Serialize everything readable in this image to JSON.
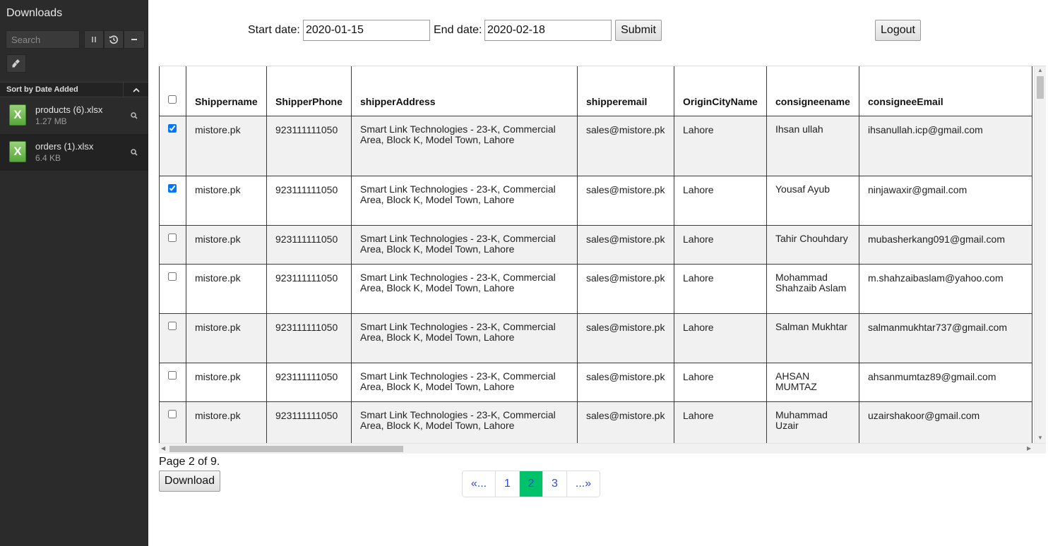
{
  "sidebar": {
    "title": "Downloads",
    "search_placeholder": "Search",
    "sort_label": "Sort by Date Added",
    "items": [
      {
        "name": "products (6).xlsx",
        "size": "1.27 MB",
        "icon": "excel-file-icon",
        "icon_letter": "X"
      },
      {
        "name": "orders (1).xlsx",
        "size": "6.4 KB",
        "icon": "excel-file-icon",
        "icon_letter": "X"
      }
    ],
    "colors": {
      "background": "#2b2b2b",
      "excel_green": "#57a83a"
    }
  },
  "filter": {
    "start_label": "Start date:",
    "start_value": "2020-01-15",
    "end_label": "End date:",
    "end_value": "2020-02-18",
    "submit_label": "Submit",
    "logout_label": "Logout"
  },
  "table": {
    "headers": [
      "Shippername",
      "ShipperPhone",
      "shipperAddress",
      "shipperemail",
      "OriginCityName",
      "consigneename",
      "consigneeEmail"
    ],
    "rows": [
      {
        "checked": true,
        "cells": [
          "mistore.pk",
          "923111111050",
          "Smart Link Technologies - 23-K, Commercial Area, Block K, Model Town, Lahore",
          "sales@mistore.pk",
          "Lahore",
          "Ihsan ullah",
          "ihsanullah.icp@gmail.com"
        ]
      },
      {
        "checked": true,
        "cells": [
          "mistore.pk",
          "923111111050",
          "Smart Link Technologies - 23-K, Commercial Area, Block K, Model Town, Lahore",
          "sales@mistore.pk",
          "Lahore",
          "Yousaf Ayub",
          "ninjawaxir@gmail.com"
        ]
      },
      {
        "checked": false,
        "cells": [
          "mistore.pk",
          "923111111050",
          "Smart Link Technologies - 23-K, Commercial Area, Block K, Model Town, Lahore",
          "sales@mistore.pk",
          "Lahore",
          "Tahir Chouhdary",
          "mubasherkang091@gmail.com"
        ]
      },
      {
        "checked": false,
        "cells": [
          "mistore.pk",
          "923111111050",
          "Smart Link Technologies - 23-K, Commercial Area, Block K, Model Town, Lahore",
          "sales@mistore.pk",
          "Lahore",
          "Mohammad Shahzaib Aslam",
          "m.shahzaibaslam@yahoo.com"
        ]
      },
      {
        "checked": false,
        "cells": [
          "mistore.pk",
          "923111111050",
          "Smart Link Technologies - 23-K, Commercial Area, Block K, Model Town, Lahore",
          "sales@mistore.pk",
          "Lahore",
          "Salman Mukhtar",
          "salmanmukhtar737@gmail.com"
        ]
      },
      {
        "checked": false,
        "cells": [
          "mistore.pk",
          "923111111050",
          "Smart Link Technologies - 23-K, Commercial Area, Block K, Model Town, Lahore",
          "sales@mistore.pk",
          "Lahore",
          "AHSAN MUMTAZ",
          "ahsanmumtaz89@gmail.com"
        ]
      },
      {
        "checked": false,
        "cells": [
          "mistore.pk",
          "923111111050",
          "Smart Link Technologies - 23-K, Commercial Area, Block K, Model Town, Lahore",
          "sales@mistore.pk",
          "Lahore",
          "Muhammad Uzair",
          "uzairshakoor@gmail.com"
        ]
      }
    ]
  },
  "footer": {
    "page_info": "Page 2 of 9.",
    "download_label": "Download",
    "pagination": [
      {
        "label": "«...",
        "active": false
      },
      {
        "label": "1",
        "active": false
      },
      {
        "label": "2",
        "active": true
      },
      {
        "label": "3",
        "active": false
      },
      {
        "label": "...»",
        "active": false
      }
    ],
    "colors": {
      "active_page": "#00c26a",
      "link": "#2a4bd7"
    }
  }
}
